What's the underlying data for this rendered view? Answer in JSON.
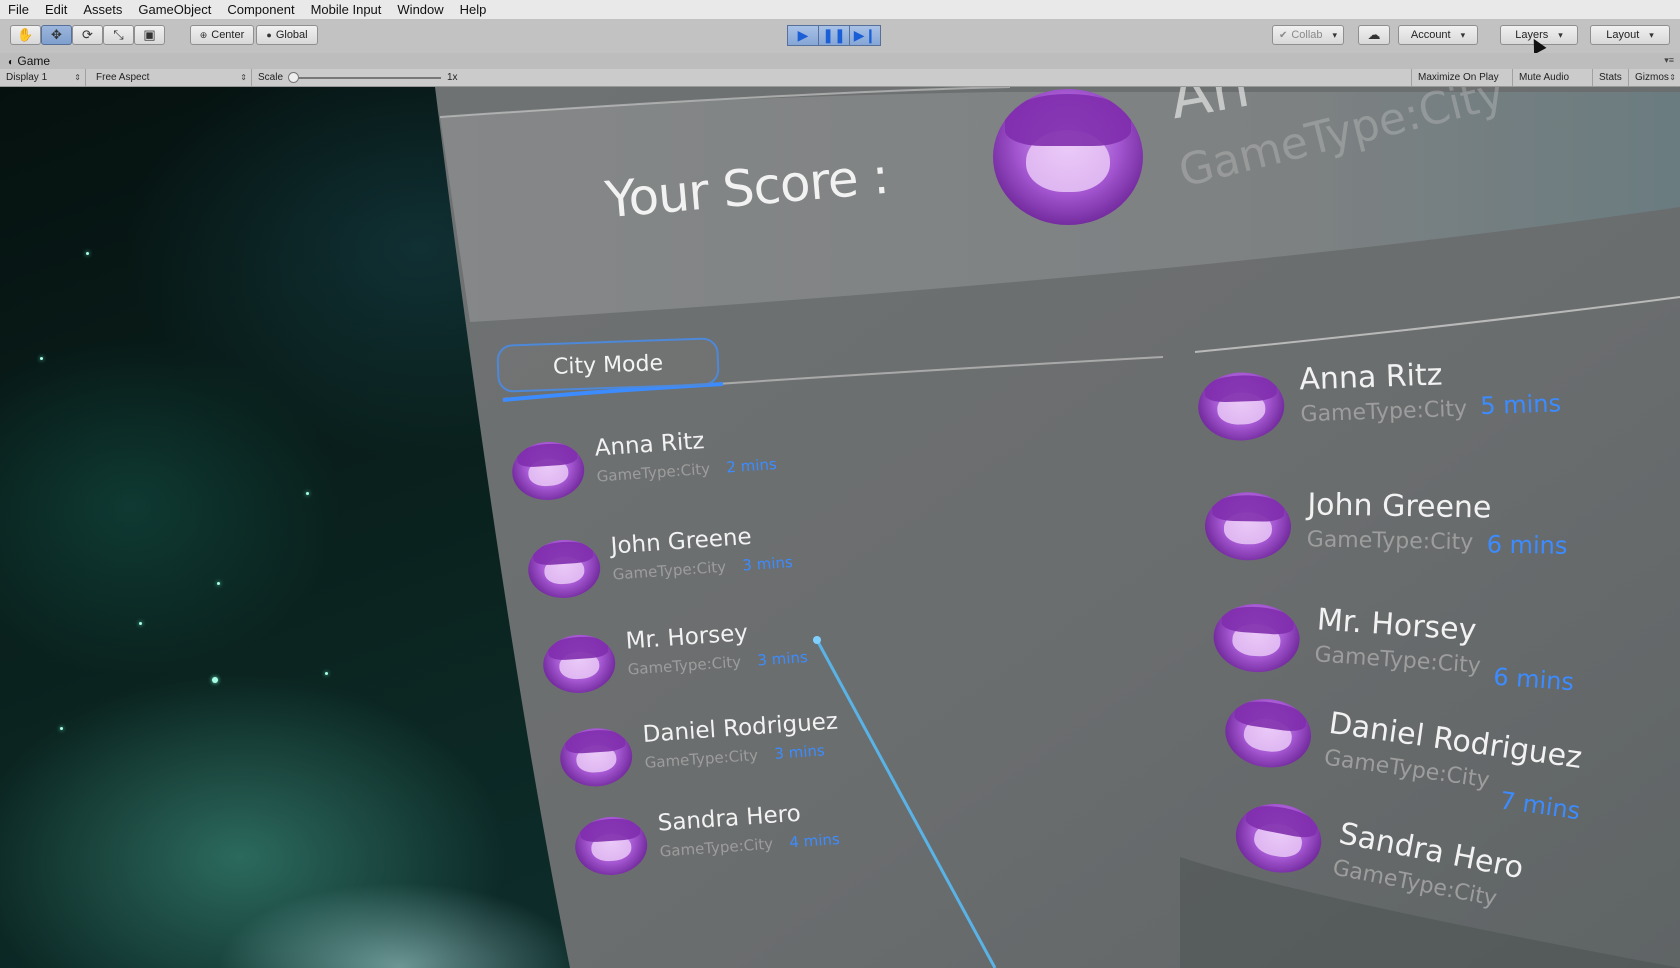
{
  "menubar": {
    "items": [
      "File",
      "Edit",
      "Assets",
      "GameObject",
      "Component",
      "Mobile Input",
      "Window",
      "Help"
    ]
  },
  "toolbar": {
    "tools": [
      "hand-icon",
      "move-icon",
      "rotate-icon",
      "scale-icon",
      "rect-icon"
    ],
    "pivot_label": "Center",
    "space_label": "Global",
    "collab_label": "Collab",
    "account_label": "Account",
    "layers_label": "Layers",
    "layout_label": "Layout",
    "play_state": "playing",
    "accent_color": "#1b5fd6"
  },
  "game_tab": {
    "title": "Game"
  },
  "game_controls": {
    "display": "Display 1",
    "aspect": "Free Aspect",
    "scale_label": "Scale",
    "scale_value": "1x",
    "maximize_label": "Maximize On Play",
    "mute_label": "Mute Audio",
    "stats_label": "Stats",
    "gizmos_label": "Gizmos"
  },
  "scene": {
    "score_label": "Your Score :",
    "ghost_title": "An",
    "ghost_subtitle": "GameType:City",
    "mode_button": "City Mode",
    "left_list": [
      {
        "name": "Anna Ritz",
        "type": "GameType:City",
        "time": "2 mins"
      },
      {
        "name": "John Greene",
        "type": "GameType:City",
        "time": "3 mins"
      },
      {
        "name": "Mr. Horsey",
        "type": "GameType:City",
        "time": "3 mins"
      },
      {
        "name": "Daniel Rodriguez",
        "type": "GameType:City",
        "time": "3 mins"
      },
      {
        "name": "Sandra Hero",
        "type": "GameType:City",
        "time": "4 mins"
      }
    ],
    "right_list": [
      {
        "name": "Anna Ritz",
        "type": "GameType:City",
        "time": "5 mins"
      },
      {
        "name": "John Greene",
        "type": "GameType:City",
        "time": "6 mins"
      },
      {
        "name": "Mr. Horsey",
        "type": "GameType:City",
        "time": "6 mins"
      },
      {
        "name": "Daniel Rodriguez",
        "type": "GameType:City",
        "time": "7 mins"
      },
      {
        "name": "Sandra Hero",
        "type": "GameType:City",
        "time": ""
      }
    ],
    "highlight_color": "#3c8cff"
  }
}
